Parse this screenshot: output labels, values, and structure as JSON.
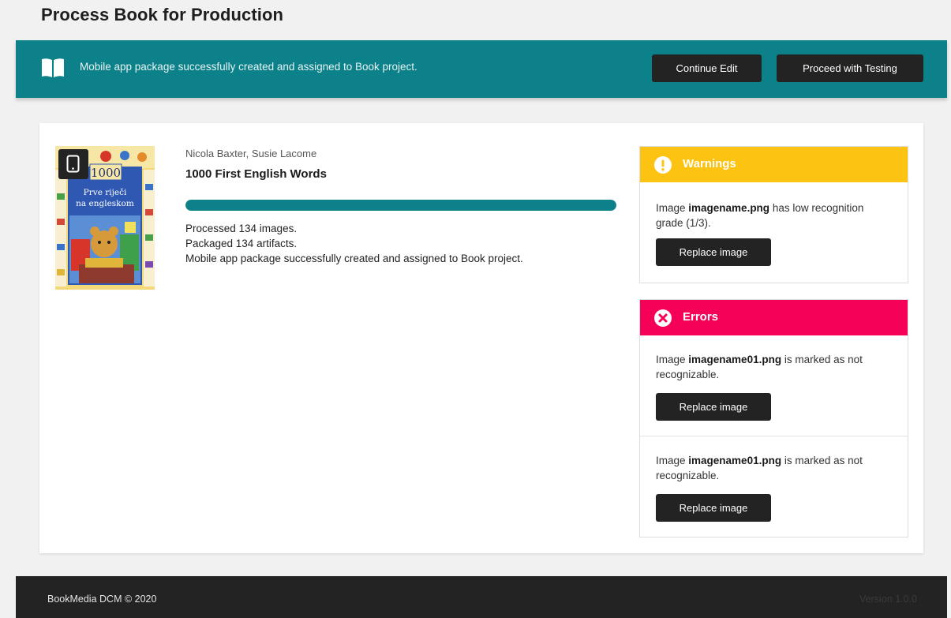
{
  "page": {
    "title": "Process Book for Production"
  },
  "banner": {
    "message": "Mobile app package successfully created and assigned to Book project.",
    "icon": "open-book-icon",
    "continue_label": "Continue Edit",
    "proceed_label": "Proceed with Testing"
  },
  "book": {
    "authors": "Nicola Baxter, Susie Lacome",
    "title": "1000 First English Words",
    "cover_badge_icon": "mobile-phone-icon",
    "cover_text": {
      "number": "1000",
      "line1": "Prve riječi",
      "line2": "na engleskom"
    },
    "progress_fraction": 1.0,
    "log": [
      "Processed 134 images.",
      "Packaged 134 artifacts.",
      "Mobile app package successfully created and assigned to Book project."
    ]
  },
  "warnings": {
    "title": "Warnings",
    "icon": "exclamation-circle-icon",
    "items": [
      {
        "prefix": "Image ",
        "filename": "imagename.png",
        "suffix": " has low recognition grade (1/3).",
        "button": "Replace image"
      }
    ]
  },
  "errors": {
    "title": "Errors",
    "icon": "x-circle-icon",
    "items": [
      {
        "prefix": "Image ",
        "filename": "imagename01.png",
        "suffix": " is marked as not recognizable.",
        "button": "Replace image"
      },
      {
        "prefix": "Image ",
        "filename": "imagename01.png",
        "suffix": " is marked as not recognizable.",
        "button": "Replace image"
      }
    ]
  },
  "footer": {
    "copyright": "BookMedia DCM © 2020",
    "version": "Version 1.0.0"
  },
  "colors": {
    "teal": "#0c8189",
    "warning": "#fcc312",
    "error": "#f50258",
    "dark": "#232323"
  }
}
